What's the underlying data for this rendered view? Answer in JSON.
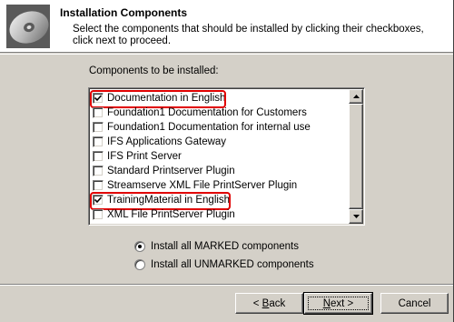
{
  "header": {
    "title": "Installation Components",
    "description": "Select the components that should be installed by clicking their checkboxes, click next to proceed.",
    "logo_icon": "cd-disc-icon"
  },
  "components": {
    "label": "Components to be installed:",
    "items": [
      {
        "label": "Documentation in English",
        "checked": true,
        "highlighted": true
      },
      {
        "label": "Foundation1 Documentation for Customers",
        "checked": false,
        "highlighted": false
      },
      {
        "label": "Foundation1 Documentation for internal use",
        "checked": false,
        "highlighted": false
      },
      {
        "label": "IFS Applications Gateway",
        "checked": false,
        "highlighted": false
      },
      {
        "label": "IFS Print Server",
        "checked": false,
        "highlighted": false
      },
      {
        "label": "Standard Printserver Plugin",
        "checked": false,
        "highlighted": false
      },
      {
        "label": "Streamserve XML File PrintServer Plugin",
        "checked": false,
        "highlighted": false
      },
      {
        "label": "TrainingMaterial in English",
        "checked": true,
        "highlighted": true
      },
      {
        "label": "XML File PrintServer Plugin",
        "checked": false,
        "highlighted": false
      }
    ]
  },
  "install_mode": {
    "options": [
      {
        "label": "Install all MARKED components",
        "selected": true
      },
      {
        "label": "Install all UNMARKED components",
        "selected": false
      }
    ]
  },
  "buttons": {
    "back_mnemonic": "B",
    "back_rest": "ack",
    "back_prefix": "< ",
    "next_mnemonic": "N",
    "next_rest": "ext >",
    "cancel": "Cancel"
  },
  "colors": {
    "highlight_border": "#e00000",
    "dialog_face": "#d4d0c8"
  }
}
